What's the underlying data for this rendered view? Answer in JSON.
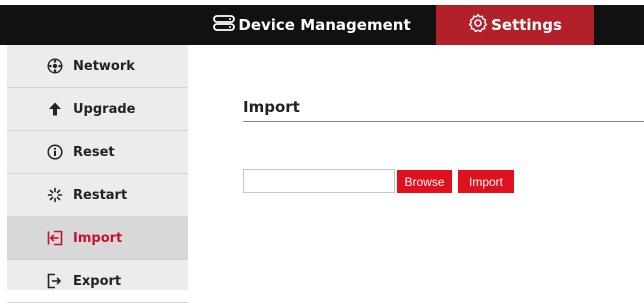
{
  "topnav": {
    "tabs": [
      {
        "label": "Device Management",
        "icon": "device-management-icon",
        "active": false
      },
      {
        "label": "Settings",
        "icon": "gear-icon",
        "active": true
      }
    ]
  },
  "sidebar": {
    "items": [
      {
        "label": "Network",
        "icon": "network-icon"
      },
      {
        "label": "Upgrade",
        "icon": "arrow-up-icon"
      },
      {
        "label": "Reset",
        "icon": "info-circle-icon"
      },
      {
        "label": "Restart",
        "icon": "spinner-icon"
      },
      {
        "label": "Import",
        "icon": "import-icon",
        "active": true
      },
      {
        "label": "Export",
        "icon": "export-icon"
      }
    ]
  },
  "main": {
    "title": "Import",
    "file_input": {
      "value": "",
      "placeholder": ""
    },
    "browse_label": "Browse",
    "import_label": "Import"
  },
  "colors": {
    "topbar": "#111111",
    "active_tab": "#b2202a",
    "accent": "#c8102e",
    "button": "#e0101e",
    "sidebar": "#ececec",
    "sidebar_active": "#d8d8d8"
  }
}
